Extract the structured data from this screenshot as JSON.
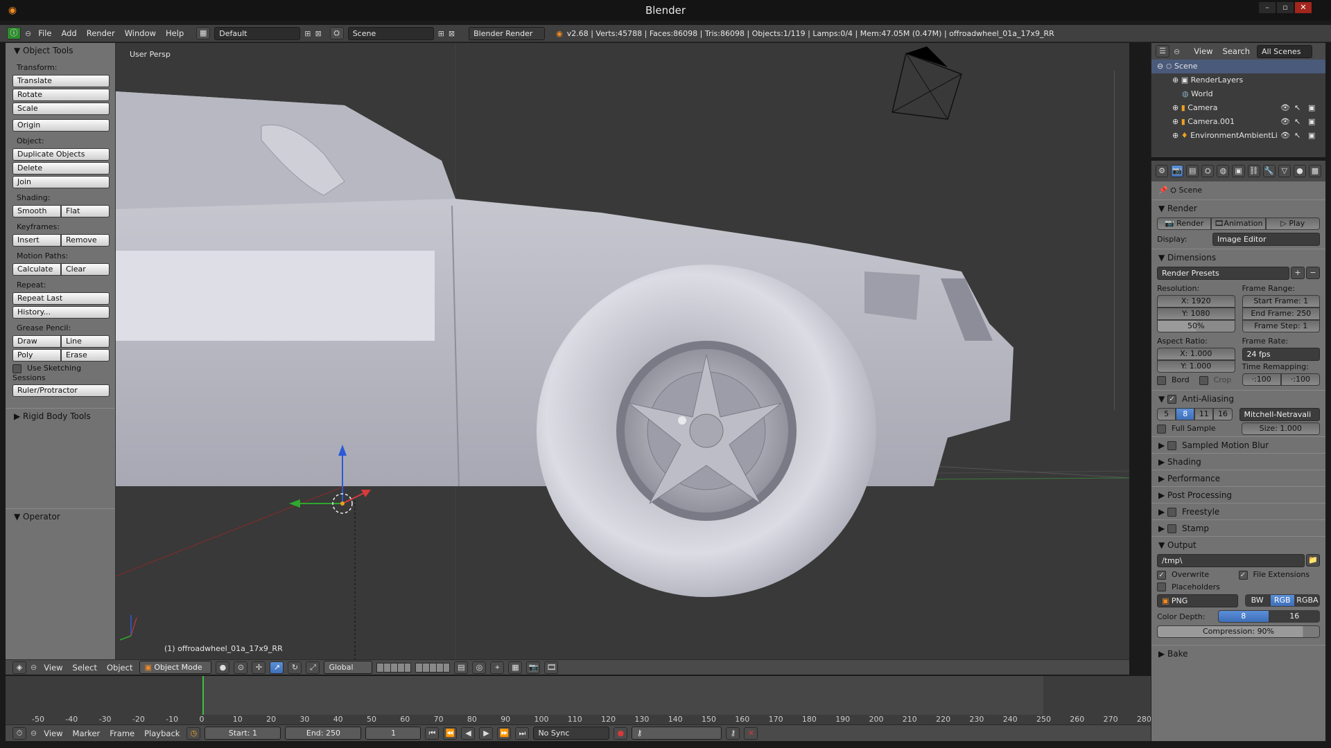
{
  "titlebar": {
    "title": "Blender"
  },
  "window_controls": {
    "minimize": "–",
    "maximize": "▫",
    "close": "✕"
  },
  "infobar": {
    "menus": [
      "File",
      "Add",
      "Render",
      "Window",
      "Help"
    ],
    "layout": "Default",
    "scene": "Scene",
    "engine": "Blender Render",
    "stats": "v2.68 | Verts:45788 | Faces:86098 | Tris:86098 | Objects:1/119 | Lamps:0/4 | Mem:47.05M (0.47M) | offroadwheel_01a_17x9_RR"
  },
  "tool_panel": {
    "header": "Object Tools",
    "transform_label": "Transform:",
    "translate": "Translate",
    "rotate": "Rotate",
    "scale": "Scale",
    "origin": "Origin",
    "object_label": "Object:",
    "duplicate": "Duplicate Objects",
    "delete": "Delete",
    "join": "Join",
    "shading_label": "Shading:",
    "smooth": "Smooth",
    "flat": "Flat",
    "keyframes_label": "Keyframes:",
    "insert": "Insert",
    "remove": "Remove",
    "motion_label": "Motion Paths:",
    "calculate": "Calculate",
    "clear": "Clear",
    "repeat_label": "Repeat:",
    "repeat_last": "Repeat Last",
    "history": "History...",
    "grease_label": "Grease Pencil:",
    "draw": "Draw",
    "line": "Line",
    "poly": "Poly",
    "erase": "Erase",
    "sketching": "Use Sketching Sessions",
    "ruler": "Ruler/Protractor",
    "rigid_body": "Rigid Body Tools",
    "operator": "Operator"
  },
  "viewport": {
    "view_label": "User Persp",
    "object_label": "(1) offroadwheel_01a_17x9_RR"
  },
  "viewport_header": {
    "menus": [
      "View",
      "Select",
      "Object"
    ],
    "mode": "Object Mode",
    "orientation": "Global"
  },
  "timeline": {
    "ticks": [
      "-50",
      "-40",
      "-30",
      "-20",
      "-10",
      "0",
      "10",
      "20",
      "30",
      "40",
      "50",
      "60",
      "70",
      "80",
      "90",
      "100",
      "110",
      "120",
      "130",
      "140",
      "150",
      "160",
      "170",
      "180",
      "190",
      "200",
      "210",
      "220",
      "230",
      "240",
      "250",
      "260",
      "270",
      "280"
    ],
    "menus": [
      "View",
      "Marker",
      "Frame",
      "Playback"
    ],
    "start": "Start: 1",
    "end": "End: 250",
    "current": "1",
    "sync": "No Sync"
  },
  "outliner": {
    "menus": [
      "View",
      "Search"
    ],
    "filter": "All Scenes",
    "items": [
      "Scene",
      "RenderLayers",
      "World",
      "Camera",
      "Camera.001",
      "EnvironmentAmbientLi"
    ]
  },
  "properties": {
    "context": "Scene",
    "render_section": "Render",
    "render_btn": "Render",
    "animation_btn": "Animation",
    "play_btn": "Play",
    "display_label": "Display:",
    "display_value": "Image Editor",
    "dimensions_section": "Dimensions",
    "render_presets": "Render Presets",
    "resolution_label": "Resolution:",
    "res_x": "X: 1920",
    "res_y": "Y: 1080",
    "res_pct": "50%",
    "frame_range_label": "Frame Range:",
    "start_frame": "Start Frame: 1",
    "end_frame": "End Frame: 250",
    "frame_step": "Frame Step: 1",
    "aspect_label": "Aspect Ratio:",
    "aspect_x": "X: 1.000",
    "aspect_y": "Y: 1.000",
    "frame_rate_label": "Frame Rate:",
    "frame_rate": "24 fps",
    "time_remap_label": "Time Remapping:",
    "remap_old": "·:100",
    "remap_new": "·:100",
    "bord": "Bord",
    "crop": "Crop",
    "aa_section": "Anti-Aliasing",
    "aa_samples": [
      "5",
      "8",
      "11",
      "16"
    ],
    "aa_filter": "Mitchell-Netravali",
    "full_sample": "Full Sample",
    "aa_size": "Size: 1.000",
    "collapsed": [
      "Sampled Motion Blur",
      "Shading",
      "Performance",
      "Post Processing",
      "Freestyle",
      "Stamp"
    ],
    "output_section": "Output",
    "output_path": "/tmp\\",
    "overwrite": "Overwrite",
    "file_ext": "File Extensions",
    "placeholders": "Placeholders",
    "format": "PNG",
    "bw": "BW",
    "rgb": "RGB",
    "rgba": "RGBA",
    "color_depth_label": "Color Depth:",
    "depth_8": "8",
    "depth_16": "16",
    "compression": "Compression: 90%",
    "bake_section": "Bake"
  }
}
